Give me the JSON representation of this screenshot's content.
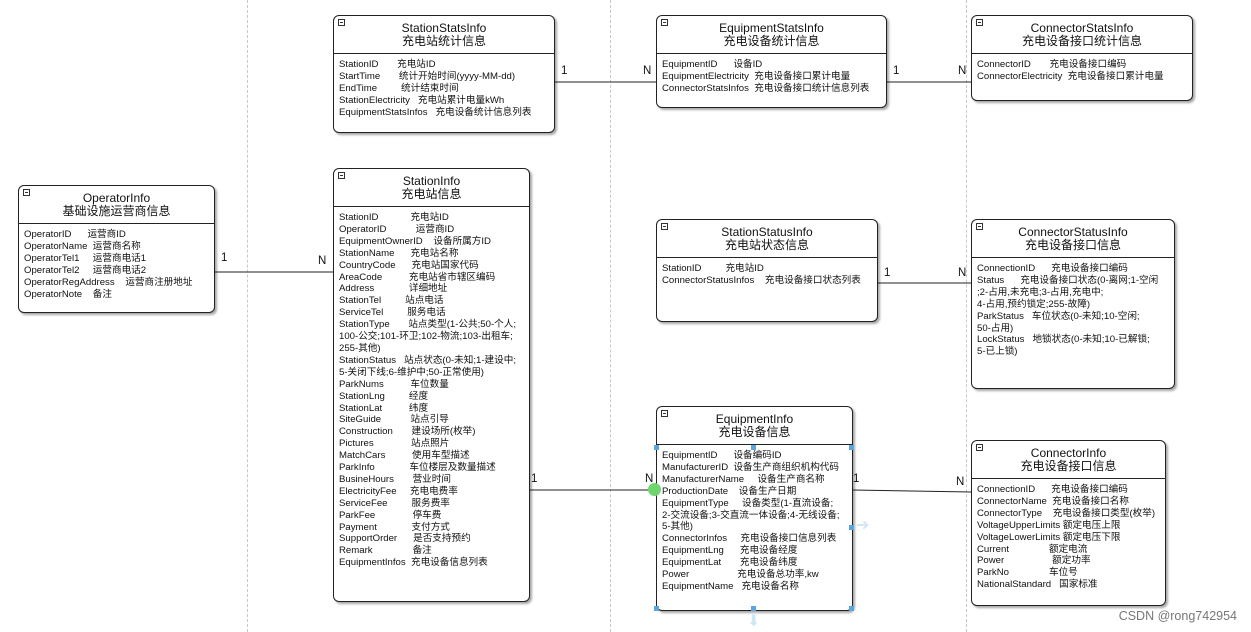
{
  "entities": {
    "operator": {
      "title": "OperatorInfo",
      "subtitle": "基础设施运营商信息",
      "fields": [
        "OperatorID      运营商ID",
        "OperatorName  运营商名称",
        "OperatorTel1     运营商电话1",
        "OperatorTel2     运营商电话2",
        "OperatorRegAddress    运营商注册地址",
        "OperatorNote    备注"
      ]
    },
    "station_stats": {
      "title": "StationStatsInfo",
      "subtitle": "充电站统计信息",
      "fields": [
        "StationID       充电站ID",
        "StartTime       统计开始时间(yyyy-MM-dd)",
        "EndTime         统计结束时间",
        "StationElectricity   充电站累计电量kWh",
        "EquipmentStatsInfos   充电设备统计信息列表"
      ]
    },
    "equipment_stats": {
      "title": "EquipmentStatsInfo",
      "subtitle": "充电设备统计信息",
      "fields": [
        "EquipmentID      设备ID",
        "EquipmentElectricity  充电设备接口累计电量",
        "ConnectorStatsInfos  充电设备接口统计信息列表"
      ]
    },
    "connector_stats": {
      "title": "ConnectorStatsInfo",
      "subtitle": "充电设备接口统计信息",
      "fields": [
        "ConnectorID       充电设备接口编码",
        "ConnectorElectricity  充电设备接口累计电量"
      ]
    },
    "station": {
      "title": "StationInfo",
      "subtitle": "充电站信息",
      "fields": [
        "StationID            充电站ID",
        "OperatorID           运营商ID",
        "EquipmentOwnerID    设备所属方ID",
        "StationName      充电站名称",
        "CountryCode      充电站国家代码",
        "AreaCode          充电站省市辖区编码",
        "Address             详细地址",
        "StationTel         站点电话",
        "ServiceTel         服务电话",
        "StationType       站点类型(1-公共;50-个人;\n100-公交;101-环卫;102-物流;103-出租车;\n255-其他)",
        "StationStatus   站点状态(0-未知;1-建设中;\n5-关闭下线;6-维护中;50-正常使用)",
        "ParkNums          车位数量",
        "StationLng         经度",
        "StationLat          纬度",
        "SiteGuide           站点引导",
        "Construction       建设场所(枚举)",
        "Pictures              站点照片",
        "MatchCars          使用车型描述",
        "ParkInfo             车位楼层及数量描述",
        "BusineHours       营业时间",
        "ElectricityFee     充电电费率",
        "ServiceFee         服务费率",
        "ParkFee              停车费",
        "Payment             支付方式",
        "SupportOrder      是否支持预约",
        "Remark               备注",
        "EquipmentInfos  充电设备信息列表"
      ]
    },
    "station_status": {
      "title": "StationStatusInfo",
      "subtitle": "充电站状态信息",
      "fields": [
        "StationID         充电站ID",
        "ConnectorStatusInfos    充电设备接口状态列表"
      ]
    },
    "connector_status": {
      "title": "ConnectorStatusInfo",
      "subtitle": "充电设备接口信息",
      "fields": [
        "ConnectionID      充电设备接口编码",
        "Status      充电设备接口状态(0-离网;1-空闲\n;2-占用,未充电;3-占用,充电中;\n4-占用,预约锁定;255-故障)",
        "ParkStatus   车位状态(0-未知;10-空闲;\n50-占用)",
        "LockStatus   地锁状态(0-未知;10-已解锁;\n5-已上锁)"
      ]
    },
    "equipment": {
      "title": "EquipmentInfo",
      "subtitle": "充电设备信息",
      "fields": [
        "EquipmentID      设备编码ID",
        "ManufacturerID  设备生产商组织机构代码",
        "ManufacturerName     设备生产商名称",
        "ProductionDate    设备生产日期",
        "EquipmentType     设备类型(1-直流设备;\n2-交流设备;3-交直流一体设备;4-无线设备;\n5-其他)",
        "ConnectorInfos     充电设备接口信息列表",
        "EquipmentLng      充电设备经度",
        "EquipmentLat       充电设备纬度",
        "Power                  充电设备总功率,kw",
        "EquipmentName   充电设备名称"
      ]
    },
    "connector": {
      "title": "ConnectorInfo",
      "subtitle": "充电设备接口信息",
      "fields": [
        "ConnectionID      充电设备接口编码",
        "ConnectorName  充电设备接口名称",
        "ConnectorType    充电设备接口类型(枚举)",
        "VoltageUpperLimits 额定电压上限",
        "VoltageLowerLimits 额定电压下限",
        "Current               额定电流",
        "Power                  额定功率",
        "ParkNo               车位号",
        "NationalStandard   国家标准"
      ]
    }
  },
  "multiplicities": {
    "one": "1",
    "many": "N"
  },
  "watermark": "CSDN @rong742954"
}
